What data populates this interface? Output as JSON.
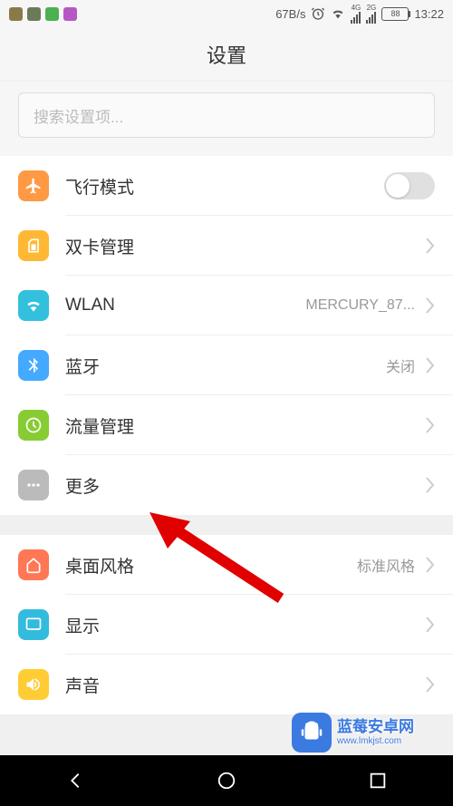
{
  "status": {
    "net_speed": "67B/s",
    "net_type_1": "4G",
    "net_type_2": "2G",
    "battery": "88",
    "time": "13:22"
  },
  "header": {
    "title": "设置"
  },
  "search": {
    "placeholder": "搜索设置项..."
  },
  "groups": [
    {
      "items": [
        {
          "icon": "plane",
          "label": "飞行模式",
          "control": "toggle",
          "toggle": false
        },
        {
          "icon": "sim",
          "label": "双卡管理",
          "control": "arrow"
        },
        {
          "icon": "wlan",
          "label": "WLAN",
          "value": "MERCURY_87...",
          "control": "arrow"
        },
        {
          "icon": "bt",
          "label": "蓝牙",
          "value": "关闭",
          "control": "arrow"
        },
        {
          "icon": "data",
          "label": "流量管理",
          "control": "arrow"
        },
        {
          "icon": "more",
          "label": "更多",
          "control": "arrow"
        }
      ]
    },
    {
      "items": [
        {
          "icon": "home",
          "label": "桌面风格",
          "value": "标准风格",
          "control": "arrow"
        },
        {
          "icon": "display",
          "label": "显示",
          "control": "arrow"
        },
        {
          "icon": "sound",
          "label": "声音",
          "control": "arrow"
        }
      ]
    }
  ],
  "watermark": {
    "title": "蓝莓安卓网",
    "url": "www.lmkjst.com"
  }
}
